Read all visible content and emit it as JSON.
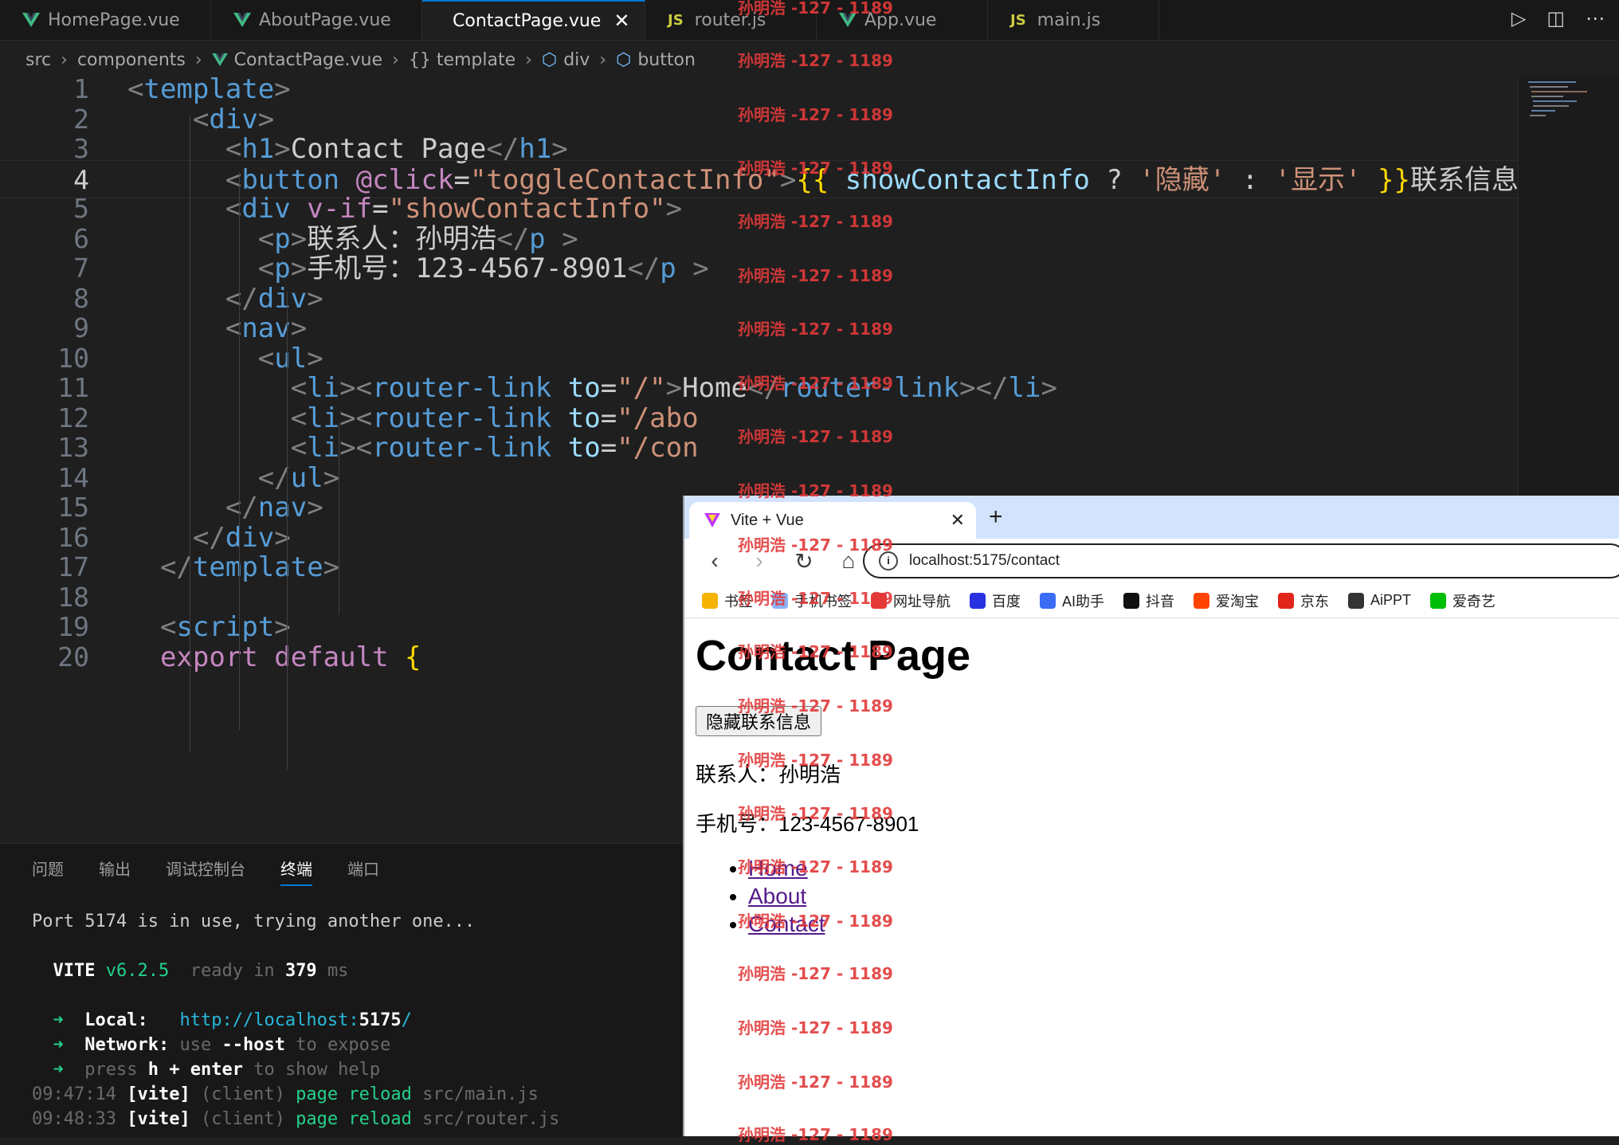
{
  "tabs": [
    {
      "label": "HomePage.vue",
      "kind": "vue"
    },
    {
      "label": "AboutPage.vue",
      "kind": "vue"
    },
    {
      "label": "ContactPage.vue",
      "kind": "vue",
      "active": true
    },
    {
      "label": "router.js",
      "kind": "js"
    },
    {
      "label": "App.vue",
      "kind": "vue"
    },
    {
      "label": "main.js",
      "kind": "js"
    }
  ],
  "tab_icon_js": "JS",
  "breadcrumb": [
    "src",
    "components",
    "ContactPage.vue",
    "{} template",
    "div",
    "button"
  ],
  "editor": {
    "lines": [
      {
        "n": "1",
        "parts": [
          [
            "t",
            "<"
          ],
          [
            "tag",
            "template"
          ],
          [
            "t",
            ">"
          ]
        ]
      },
      {
        "n": "2",
        "parts": [
          [
            "txt",
            "    "
          ],
          [
            "t",
            "<"
          ],
          [
            "tag",
            "div"
          ],
          [
            "t",
            ">"
          ]
        ]
      },
      {
        "n": "3",
        "parts": [
          [
            "txt",
            "      "
          ],
          [
            "t",
            "<"
          ],
          [
            "tag",
            "h1"
          ],
          [
            "t",
            ">"
          ],
          [
            "txt",
            "Contact Page"
          ],
          [
            "t",
            "</"
          ],
          [
            "tag",
            "h1"
          ],
          [
            "t",
            ">"
          ]
        ]
      },
      {
        "n": "4",
        "parts": [
          [
            "txt",
            "      "
          ],
          [
            "t",
            "<"
          ],
          [
            "tag",
            "button"
          ],
          [
            "txt",
            " "
          ],
          [
            "attr",
            "@click"
          ],
          [
            "txt",
            "="
          ],
          [
            "str",
            "\"toggleContactInfo\""
          ],
          [
            "t",
            ">"
          ],
          [
            "br",
            "{{"
          ],
          [
            "txt",
            " "
          ],
          [
            "var",
            "showContactInfo"
          ],
          [
            "txt",
            " ? "
          ],
          [
            "str",
            "'隐藏'"
          ],
          [
            "txt",
            " : "
          ],
          [
            "str",
            "'显示'"
          ],
          [
            "txt",
            " "
          ],
          [
            "br",
            "}}"
          ],
          [
            "txt",
            "联系信息"
          ],
          [
            "t",
            "</"
          ]
        ]
      },
      {
        "n": "5",
        "parts": [
          [
            "txt",
            "      "
          ],
          [
            "t",
            "<"
          ],
          [
            "tag",
            "div"
          ],
          [
            "txt",
            " "
          ],
          [
            "attr",
            "v-if"
          ],
          [
            "txt",
            "="
          ],
          [
            "str",
            "\"showContactInfo\""
          ],
          [
            "t",
            ">"
          ]
        ]
      },
      {
        "n": "6",
        "parts": [
          [
            "txt",
            "        "
          ],
          [
            "t",
            "<"
          ],
          [
            "tag",
            "p"
          ],
          [
            "t",
            ">"
          ],
          [
            "txt",
            "联系人：孙明浩"
          ],
          [
            "t",
            "</"
          ],
          [
            "tag",
            "p"
          ],
          [
            "txt",
            " "
          ],
          [
            "t",
            ">"
          ]
        ]
      },
      {
        "n": "7",
        "parts": [
          [
            "txt",
            "        "
          ],
          [
            "t",
            "<"
          ],
          [
            "tag",
            "p"
          ],
          [
            "t",
            ">"
          ],
          [
            "txt",
            "手机号：123-4567-8901"
          ],
          [
            "t",
            "</"
          ],
          [
            "tag",
            "p"
          ],
          [
            "txt",
            " "
          ],
          [
            "t",
            ">"
          ]
        ]
      },
      {
        "n": "8",
        "parts": [
          [
            "txt",
            "      "
          ],
          [
            "t",
            "</"
          ],
          [
            "tag",
            "div"
          ],
          [
            "t",
            ">"
          ]
        ]
      },
      {
        "n": "9",
        "parts": [
          [
            "txt",
            "      "
          ],
          [
            "t",
            "<"
          ],
          [
            "tag",
            "nav"
          ],
          [
            "t",
            ">"
          ]
        ]
      },
      {
        "n": "10",
        "parts": [
          [
            "txt",
            "        "
          ],
          [
            "t",
            "<"
          ],
          [
            "tag",
            "ul"
          ],
          [
            "t",
            ">"
          ]
        ]
      },
      {
        "n": "11",
        "parts": [
          [
            "txt",
            "          "
          ],
          [
            "t",
            "<"
          ],
          [
            "tag",
            "li"
          ],
          [
            "t",
            "><"
          ],
          [
            "tag",
            "router-link"
          ],
          [
            "txt",
            " "
          ],
          [
            "var",
            "to"
          ],
          [
            "txt",
            "="
          ],
          [
            "str",
            "\"/\""
          ],
          [
            "t",
            ">"
          ],
          [
            "txt",
            "Home"
          ],
          [
            "t",
            "</"
          ],
          [
            "tag",
            "router-link"
          ],
          [
            "t",
            "></"
          ],
          [
            "tag",
            "li"
          ],
          [
            "t",
            ">"
          ]
        ]
      },
      {
        "n": "12",
        "parts": [
          [
            "txt",
            "          "
          ],
          [
            "t",
            "<"
          ],
          [
            "tag",
            "li"
          ],
          [
            "t",
            "><"
          ],
          [
            "tag",
            "router-link"
          ],
          [
            "txt",
            " "
          ],
          [
            "var",
            "to"
          ],
          [
            "txt",
            "="
          ],
          [
            "str",
            "\"/abo"
          ]
        ]
      },
      {
        "n": "13",
        "parts": [
          [
            "txt",
            "          "
          ],
          [
            "t",
            "<"
          ],
          [
            "tag",
            "li"
          ],
          [
            "t",
            "><"
          ],
          [
            "tag",
            "router-link"
          ],
          [
            "txt",
            " "
          ],
          [
            "var",
            "to"
          ],
          [
            "txt",
            "="
          ],
          [
            "str",
            "\"/con"
          ]
        ]
      },
      {
        "n": "14",
        "parts": [
          [
            "txt",
            "        "
          ],
          [
            "t",
            "</"
          ],
          [
            "tag",
            "ul"
          ],
          [
            "t",
            ">"
          ]
        ]
      },
      {
        "n": "15",
        "parts": [
          [
            "txt",
            "      "
          ],
          [
            "t",
            "</"
          ],
          [
            "tag",
            "nav"
          ],
          [
            "t",
            ">"
          ]
        ]
      },
      {
        "n": "16",
        "parts": [
          [
            "txt",
            "    "
          ],
          [
            "t",
            "</"
          ],
          [
            "tag",
            "div"
          ],
          [
            "t",
            ">"
          ]
        ]
      },
      {
        "n": "17",
        "parts": [
          [
            "txt",
            "  "
          ],
          [
            "t",
            "</"
          ],
          [
            "tag",
            "template"
          ],
          [
            "t",
            ">"
          ]
        ]
      },
      {
        "n": "18",
        "parts": []
      },
      {
        "n": "19",
        "parts": [
          [
            "txt",
            "  "
          ],
          [
            "t",
            "<"
          ],
          [
            "tag",
            "script"
          ],
          [
            "t",
            ">"
          ]
        ]
      },
      {
        "n": "20",
        "parts": [
          [
            "txt",
            "  "
          ],
          [
            "kw",
            "export"
          ],
          [
            "txt",
            " "
          ],
          [
            "kw",
            "default"
          ],
          [
            "txt",
            " "
          ],
          [
            "br",
            "{"
          ]
        ]
      }
    ]
  },
  "panel": {
    "tabs": [
      "问题",
      "输出",
      "调试控制台",
      "终端",
      "端口"
    ],
    "active": "终端",
    "terminal": {
      "port_msg": "Port 5174 is in use, trying another one...",
      "vite_name": "VITE",
      "vite_ver": "v6.2.5",
      "ready_prefix": "ready in",
      "ready_ms": "379",
      "ready_unit": "ms",
      "local_label": "Local:",
      "local_url_a": "http://localhost:",
      "local_url_port": "5175",
      "local_url_b": "/",
      "network_label": "Network:",
      "network_a": "use",
      "network_flag": "--host",
      "network_b": "to expose",
      "press_a": "press",
      "press_key": "h + enter",
      "press_b": "to show help",
      "log1_time": "09:47:14",
      "log1_tag": "[vite]",
      "log1_client": "(client)",
      "log1_action": "page reload",
      "log1_file": "src/main.js",
      "log2_time": "09:48:33",
      "log2_tag": "[vite]",
      "log2_client": "(client)",
      "log2_action": "page reload",
      "log2_file": "src/router.js",
      "arrow": "➜"
    }
  },
  "browser": {
    "tab_title": "Vite + Vue",
    "url": "localhost:5175/contact",
    "bookmarks": [
      {
        "label": "书签",
        "color": "#f4b400"
      },
      {
        "label": "手机书签",
        "color": "#8ab4f8"
      },
      {
        "label": "网址导航",
        "color": "#e53935"
      },
      {
        "label": "百度",
        "color": "#2932e1"
      },
      {
        "label": "AI助手",
        "color": "#3b6cf6"
      },
      {
        "label": "抖音",
        "color": "#111111"
      },
      {
        "label": "爱淘宝",
        "color": "#ff4400"
      },
      {
        "label": "京东",
        "color": "#e1251b"
      },
      {
        "label": "AiPPT",
        "color": "#333333"
      },
      {
        "label": "爱奇艺",
        "color": "#00be06"
      }
    ],
    "page": {
      "h1": "Contact Page",
      "button": "隐藏联系信息",
      "contact": "联系人：孙明浩",
      "phone": "手机号：123-4567-8901",
      "links": [
        "Home",
        "About",
        "Contact"
      ]
    }
  },
  "watermark": "孙明浩 -127 - 1189"
}
